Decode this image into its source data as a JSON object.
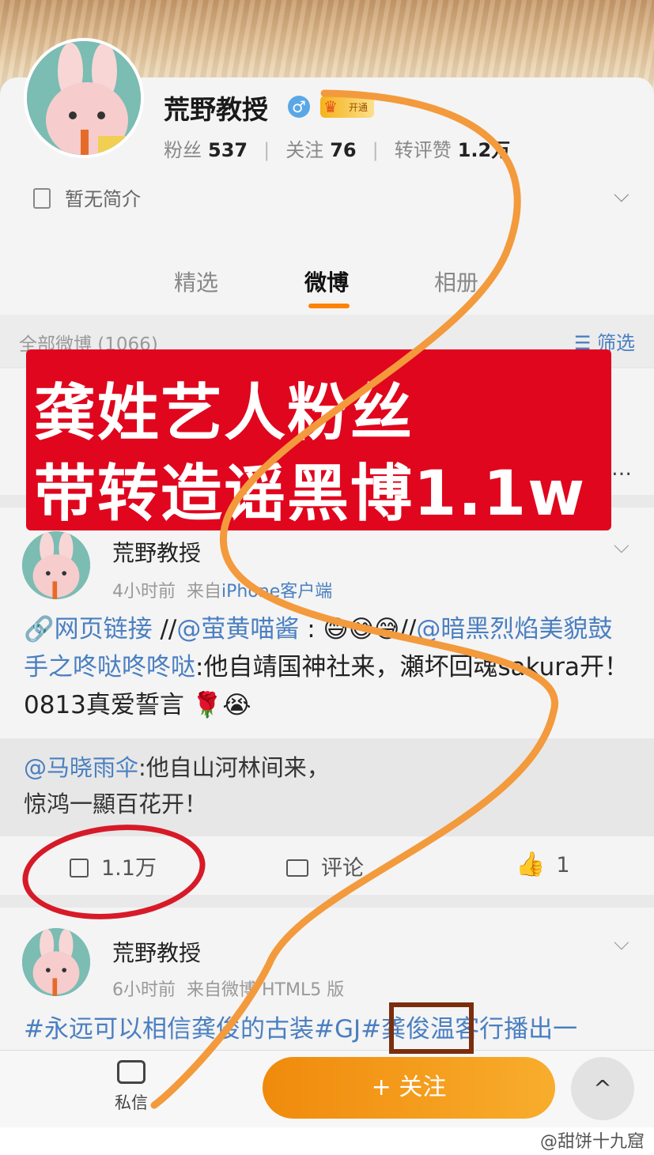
{
  "profile": {
    "username": "荒野教授",
    "vip_label": "开通",
    "gender_symbol": "♂",
    "stats": {
      "fans_label": "粉丝",
      "fans_value": "537",
      "following_label": "关注",
      "following_value": "76",
      "reactions_label": "转评赞",
      "reactions_value": "1.2万"
    },
    "bio": "暂无简介"
  },
  "tabs": [
    {
      "label": "精选"
    },
    {
      "label": "微博"
    },
    {
      "label": "相册"
    }
  ],
  "filter_bar": {
    "count_label": "全部微博 (1066)",
    "filter_label": "筛选"
  },
  "card1": {
    "ellipsis": "…"
  },
  "overlay": {
    "line1": "龚姓艺人粉丝",
    "line2": "带转造谣黑博1.1w"
  },
  "post1": {
    "author": "荒野教授",
    "time": "4小时前",
    "source_prefix": "来自",
    "source": "iPhone客户端",
    "text_link1": "网页链接",
    "text_sep1": " //",
    "text_mention1": "@萤黄喵酱",
    "text_emoji": " : 😅😅😅",
    "text_sep2": "//",
    "text_mention2": "@暗黑烈焰美貌鼓手之咚哒咚咚哒",
    "text_body": ":他自靖国神社来，瀬坏回魂sakura开！0813真爱誓言 🌹😭",
    "quote_mention": "@马晓雨伞",
    "quote_text1": ":他自山河林间来，",
    "quote_text2": "惊鸿一顯百花开！",
    "reposts": "1.1万",
    "comments": "评论",
    "likes": "1"
  },
  "post2": {
    "author": "荒野教授",
    "time": "6小时前",
    "source": "来自微博 HTML5 版",
    "text": "#永远可以相信龚俊的古装#GJ#龚俊温客行播出一"
  },
  "bottom_bar": {
    "dm_label": "私信",
    "follow_label": "+ 关注",
    "scroll_top": "^"
  },
  "watermark": "@甜饼十九窟",
  "colors": {
    "accent_orange": "#ff8200",
    "link_blue": "#4a7fc1",
    "overlay_red": "#e0061e",
    "annotation_orange": "#f39a3c"
  }
}
